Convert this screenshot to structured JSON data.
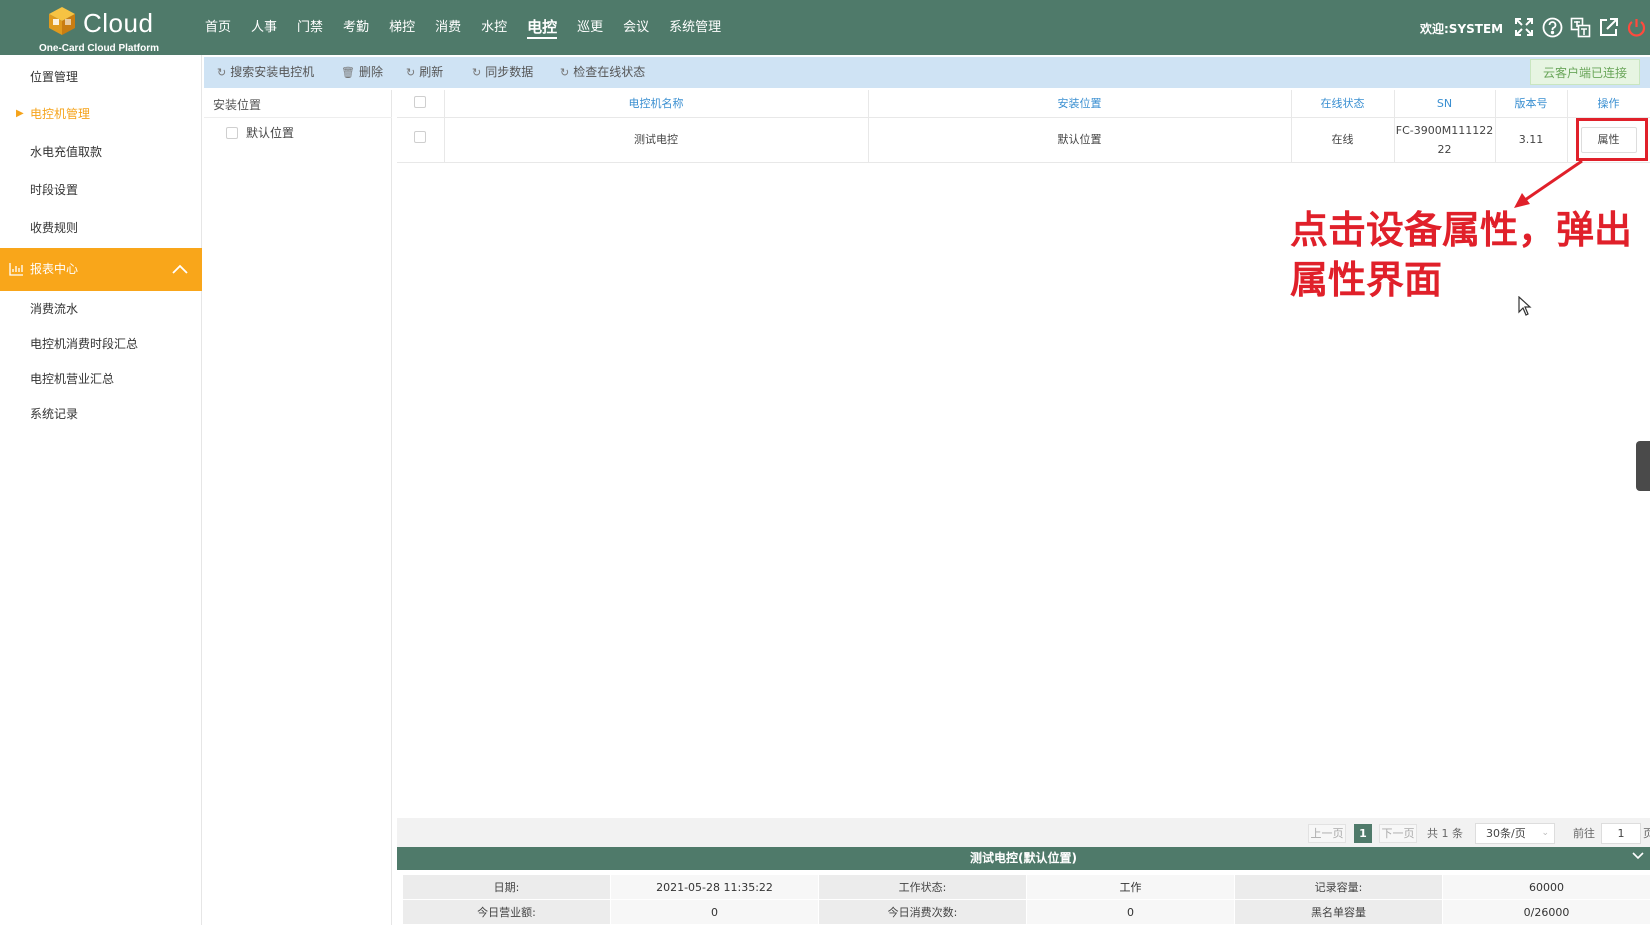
{
  "app": {
    "brand": "Cloud",
    "subtitle": "One-Card Cloud Platform",
    "welcome": "欢迎:SYSTEM"
  },
  "nav": [
    {
      "label": "首页"
    },
    {
      "label": "人事"
    },
    {
      "label": "门禁"
    },
    {
      "label": "考勤"
    },
    {
      "label": "梯控"
    },
    {
      "label": "消费"
    },
    {
      "label": "水控"
    },
    {
      "label": "电控",
      "active": true
    },
    {
      "label": "巡更"
    },
    {
      "label": "会议"
    },
    {
      "label": "系统管理"
    }
  ],
  "header_icons": [
    "fullscreen-icon",
    "help-icon",
    "language-icon",
    "external-link-icon",
    "power-icon"
  ],
  "sidebar": {
    "items": [
      {
        "label": "位置管理"
      },
      {
        "label": "电控机管理",
        "active": true
      },
      {
        "label": "水电充值取款"
      },
      {
        "label": "时段设置"
      },
      {
        "label": "收费规则"
      }
    ],
    "section": {
      "label": "报表中心"
    },
    "report_items": [
      {
        "label": "消费流水"
      },
      {
        "label": "电控机消费时段汇总"
      },
      {
        "label": "电控机营业汇总"
      },
      {
        "label": "系统记录"
      }
    ]
  },
  "toolbar": {
    "search_install": "搜索安装电控机",
    "delete": "删除",
    "refresh": "刷新",
    "sync": "同步数据",
    "check_online": "检查在线状态",
    "cloud_status": "云客户端已连接"
  },
  "tree": {
    "title": "安装位置",
    "node": "默认位置"
  },
  "table": {
    "headers": [
      "电控机名称",
      "安装位置",
      "在线状态",
      "SN",
      "版本号",
      "操作"
    ],
    "rows": [
      {
        "name": "测试电控",
        "location": "默认位置",
        "status": "在线",
        "sn_line1": "FC-3900M111122",
        "sn_line2": "22",
        "version": "3.11",
        "action": "属性"
      }
    ]
  },
  "annotation": {
    "line1": "点击设备属性，弹出",
    "line2": "属性界面",
    "color": "#e0202a"
  },
  "pager": {
    "prev": "上一页",
    "current": "1",
    "next": "下一页",
    "total": "共 1 条",
    "page_size": "30条/页",
    "goto_label": "前往",
    "goto_value": "1",
    "page_suffix": "页"
  },
  "detail": {
    "title": "测试电控(默认位置)",
    "row1": {
      "date_label": "日期:",
      "date_value": "2021-05-28 11:35:22",
      "work_label": "工作状态:",
      "work_value": "工作",
      "capacity_label": "记录容量:",
      "capacity_value": "60000"
    },
    "row2": {
      "revenue_label": "今日营业额:",
      "revenue_value": "0",
      "count_label": "今日消费次数:",
      "count_value": "0",
      "blacklist_label": "黑名单容量",
      "blacklist_value": "0/26000"
    }
  },
  "colors": {
    "header_bg": "#4f7a6a",
    "accent_orange": "#f9a61a",
    "toolbar_bg": "#cfe3f4",
    "table_header_text": "#3a8fd1"
  }
}
